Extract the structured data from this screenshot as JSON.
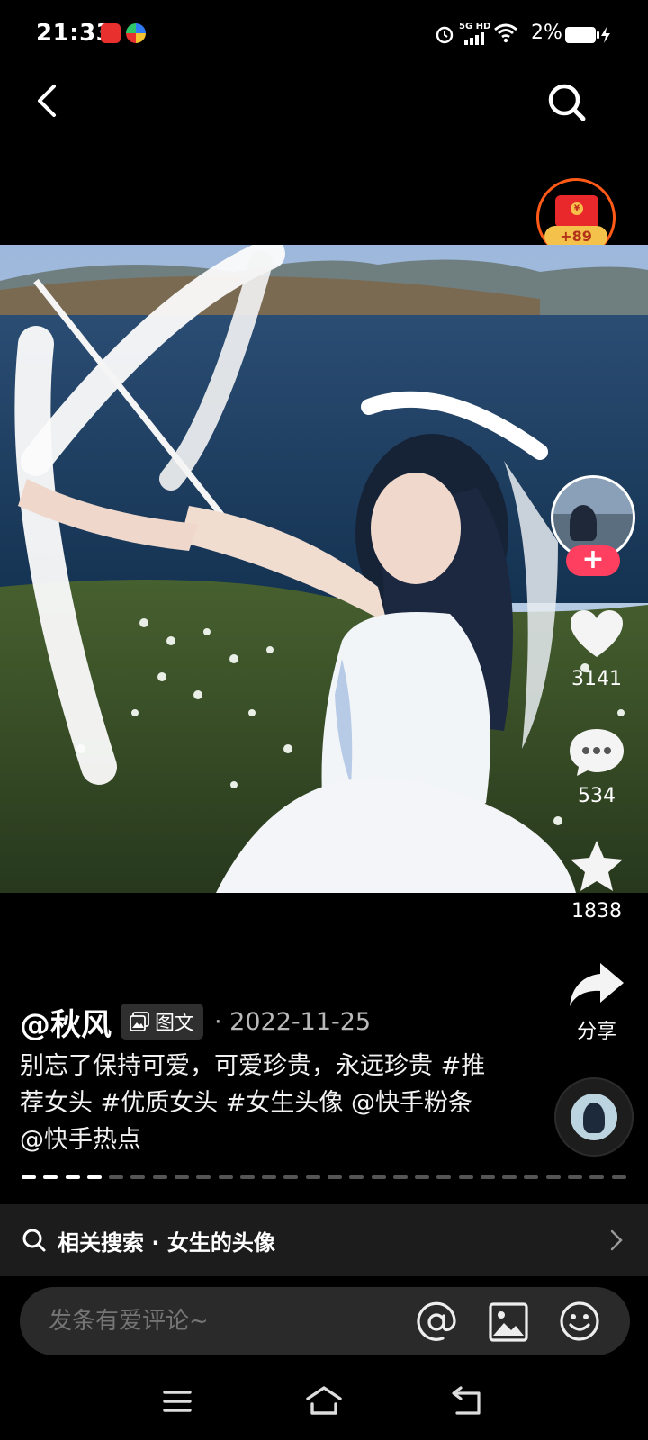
{
  "status_bar": {
    "time": "21:33",
    "network": "5G HD",
    "battery": "2%",
    "icons": [
      "alarm-icon",
      "signal-icon",
      "wifi-icon",
      "battery-icon",
      "charging-icon"
    ]
  },
  "header": {
    "back_icon": "chevron-left-icon",
    "search_icon": "search-icon"
  },
  "reward": {
    "count": "+89"
  },
  "side_actions": {
    "follow_symbol": "+",
    "like_count": "3141",
    "comment_count": "534",
    "collect_count": "1838",
    "share_label": "分享"
  },
  "post": {
    "author": "@秋风",
    "type_badge": "图文",
    "date": "· 2022-11-25",
    "caption": "别忘了保持可爱，可爱珍贵，永远珍贵 #推荐女头 #优质女头 #女生头像 @快手粉条 @快手热点",
    "progress": {
      "total_pages": 28,
      "current_page": 4
    }
  },
  "related_search": {
    "text": "相关搜索 · 女生的头像"
  },
  "comment_bar": {
    "placeholder": "发条有爱评论~"
  },
  "nav_bar": {
    "icons": [
      "menu-icon",
      "home-icon",
      "back-icon"
    ]
  },
  "colors": {
    "follow": "#ff3f5f",
    "reward_ring": "#ff5a17",
    "background": "#000000"
  }
}
